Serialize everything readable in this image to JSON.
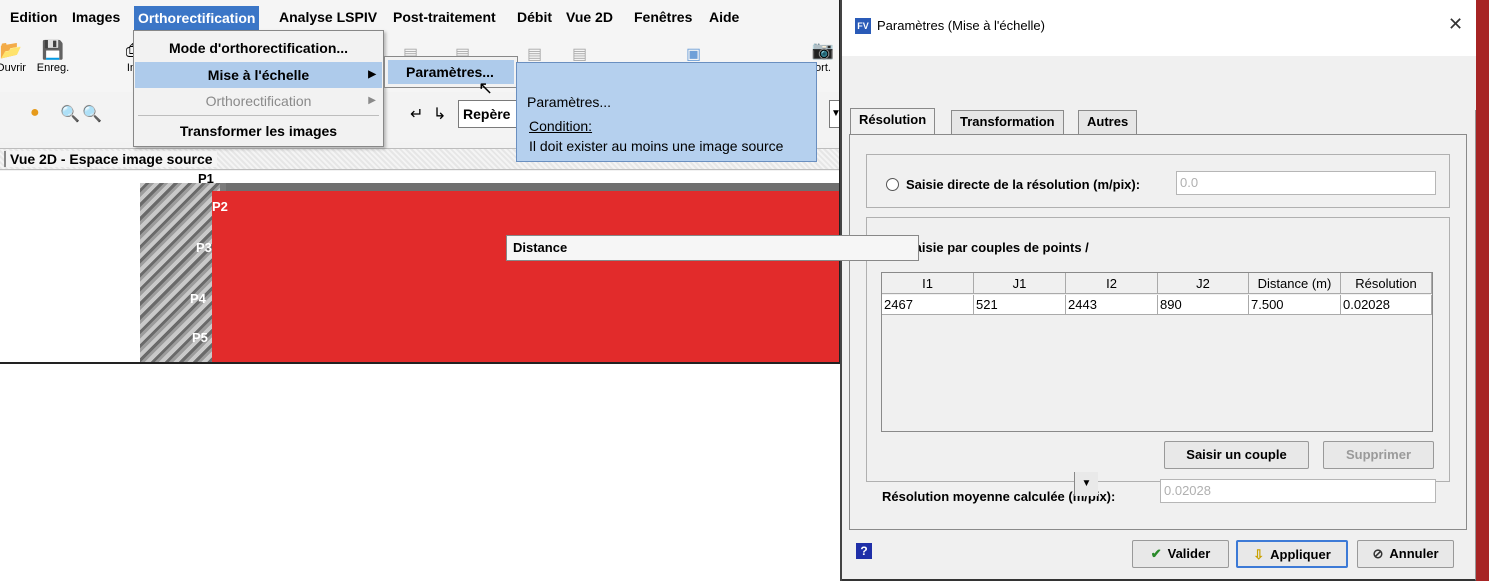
{
  "app": {
    "menu": [
      "Edition",
      "Images",
      "Orthorectification",
      "Analyse LSPIV",
      "Post-traitement",
      "Débit",
      "Vue 2D",
      "Fenêtres",
      "Aide"
    ],
    "active_menu_index": 2,
    "toolbar": [
      {
        "icon": "open-folder-icon",
        "label": "Ouvrir"
      },
      {
        "icon": "save-icon",
        "label": "Enreg."
      },
      {
        "icon": "import-icon",
        "label": "Im"
      },
      {
        "icon": "export-icon",
        "label": "ort."
      }
    ],
    "repere_combo": "Repère",
    "dropdown": {
      "items": [
        "Mode d'orthorectification...",
        "Mise à l'échelle",
        "Orthorectification",
        "Transformer les images"
      ],
      "active_index": 1,
      "disabled_index": 2
    },
    "submenu": {
      "item": "Paramètres..."
    },
    "tooltip": {
      "title": "Paramètres...",
      "condition_label": "Condition:",
      "condition_text": "Il doit exister au moins une image source"
    },
    "view": {
      "title": "Vue 2D - Espace image source",
      "points": [
        "P1",
        "P2",
        "P3",
        "P4",
        "P5"
      ]
    }
  },
  "dialog": {
    "title": "Paramètres (Mise à l'échelle)",
    "tabs": [
      "Résolution",
      "Transformation",
      "Autres"
    ],
    "selected_tab": 0,
    "direct": {
      "label": "Saisie directe de la résolution (m/pix):",
      "value": "0.0",
      "checked": false
    },
    "couples": {
      "label": "Saisie par couples de points /",
      "combo_value": "Distance",
      "checked": true
    },
    "table": {
      "columns": [
        "I1",
        "J1",
        "I2",
        "J2",
        "Distance (m)",
        "Résolution"
      ],
      "rows": [
        [
          "2467",
          "521",
          "2443",
          "890",
          "7.500",
          "0.02028"
        ]
      ]
    },
    "buttons": {
      "saisir": "Saisir un couple",
      "supprimer": "Supprimer",
      "valider": "Valider",
      "appliquer": "Appliquer",
      "annuler": "Annuler"
    },
    "mean_resolution": {
      "label": "Résolution moyenne calculée (m/pix):",
      "value": "0.02028"
    },
    "help_icon": "?"
  }
}
